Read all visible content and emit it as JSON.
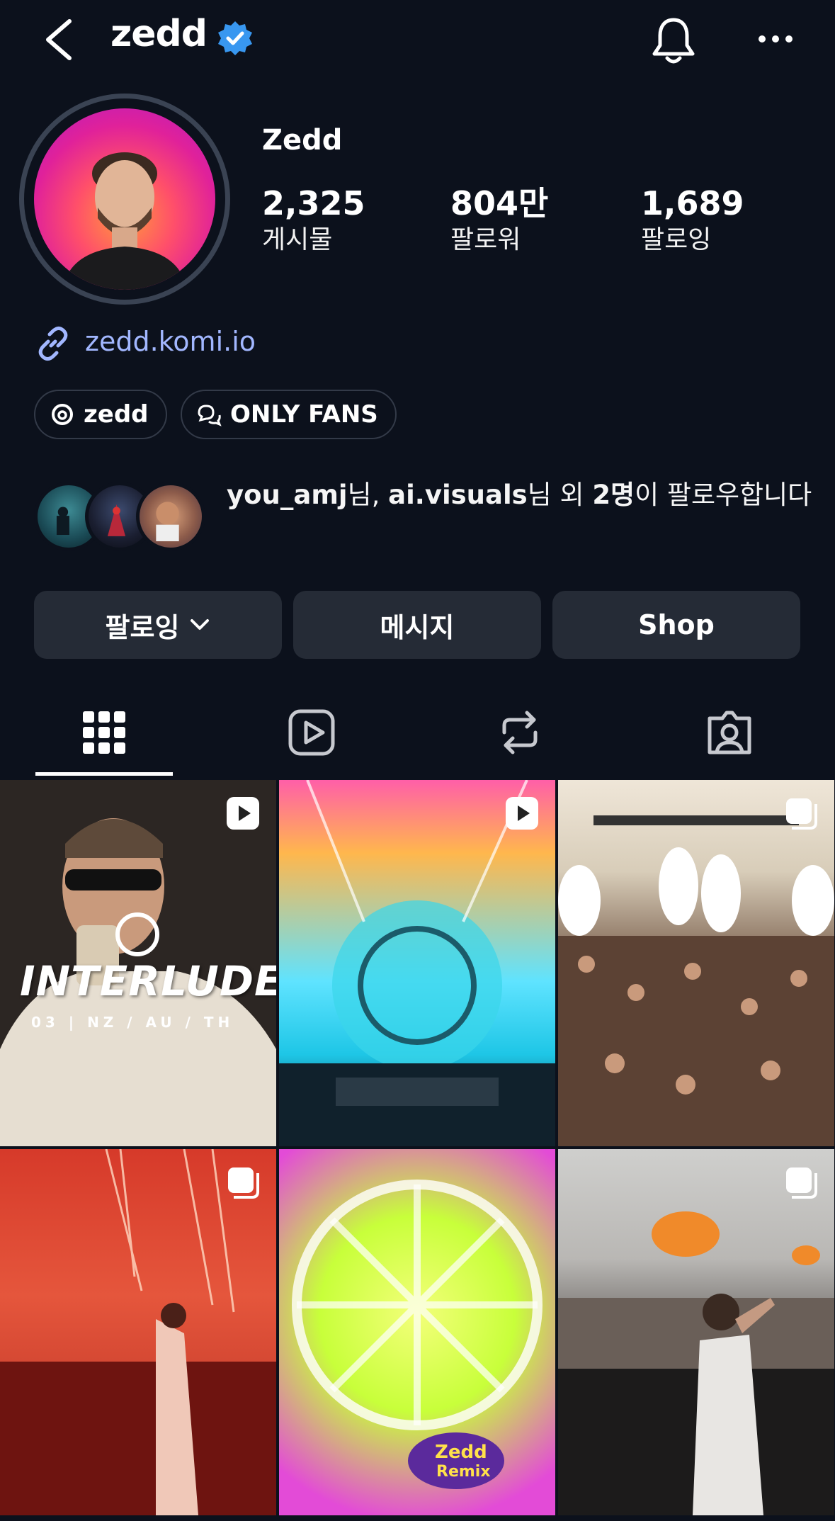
{
  "header": {
    "username": "zedd",
    "icons": [
      "back-arrow-icon",
      "verified-badge-icon",
      "bell-icon",
      "more-icon"
    ]
  },
  "profile": {
    "display_name": "Zedd",
    "stats": [
      {
        "value": "2,325",
        "label": "게시물"
      },
      {
        "value": "804만",
        "label": "팔로워"
      },
      {
        "value": "1,689",
        "label": "팔로잉"
      }
    ],
    "link": "zedd.komi.io",
    "chips": [
      {
        "label": "zedd",
        "icon": "threads-icon"
      },
      {
        "label": "ONLY FANS",
        "icon": "chat-bubbles-icon"
      }
    ]
  },
  "followed_by": {
    "name1": "you_amj",
    "suffix1": "님, ",
    "name2": "ai.visuals",
    "suffix2": "님 외 ",
    "count": "2명",
    "suffix3": "이 팔로우합니다"
  },
  "buttons": {
    "following": "팔로잉",
    "message": "메시지",
    "shop": "Shop"
  },
  "tabs": [
    "grid-icon",
    "reels-icon",
    "reposts-icon",
    "tagged-icon"
  ],
  "posts": {
    "post1_title": "INTERLUDE",
    "post1_subtitle": "03 | NZ / AU / TH",
    "post5_logo_line1": "Zedd",
    "post5_logo_line2": "Remix"
  },
  "colors": {
    "background": "#0c111c",
    "link": "#a2b7ff",
    "button": "#252b36",
    "verified": "#3897f0"
  }
}
